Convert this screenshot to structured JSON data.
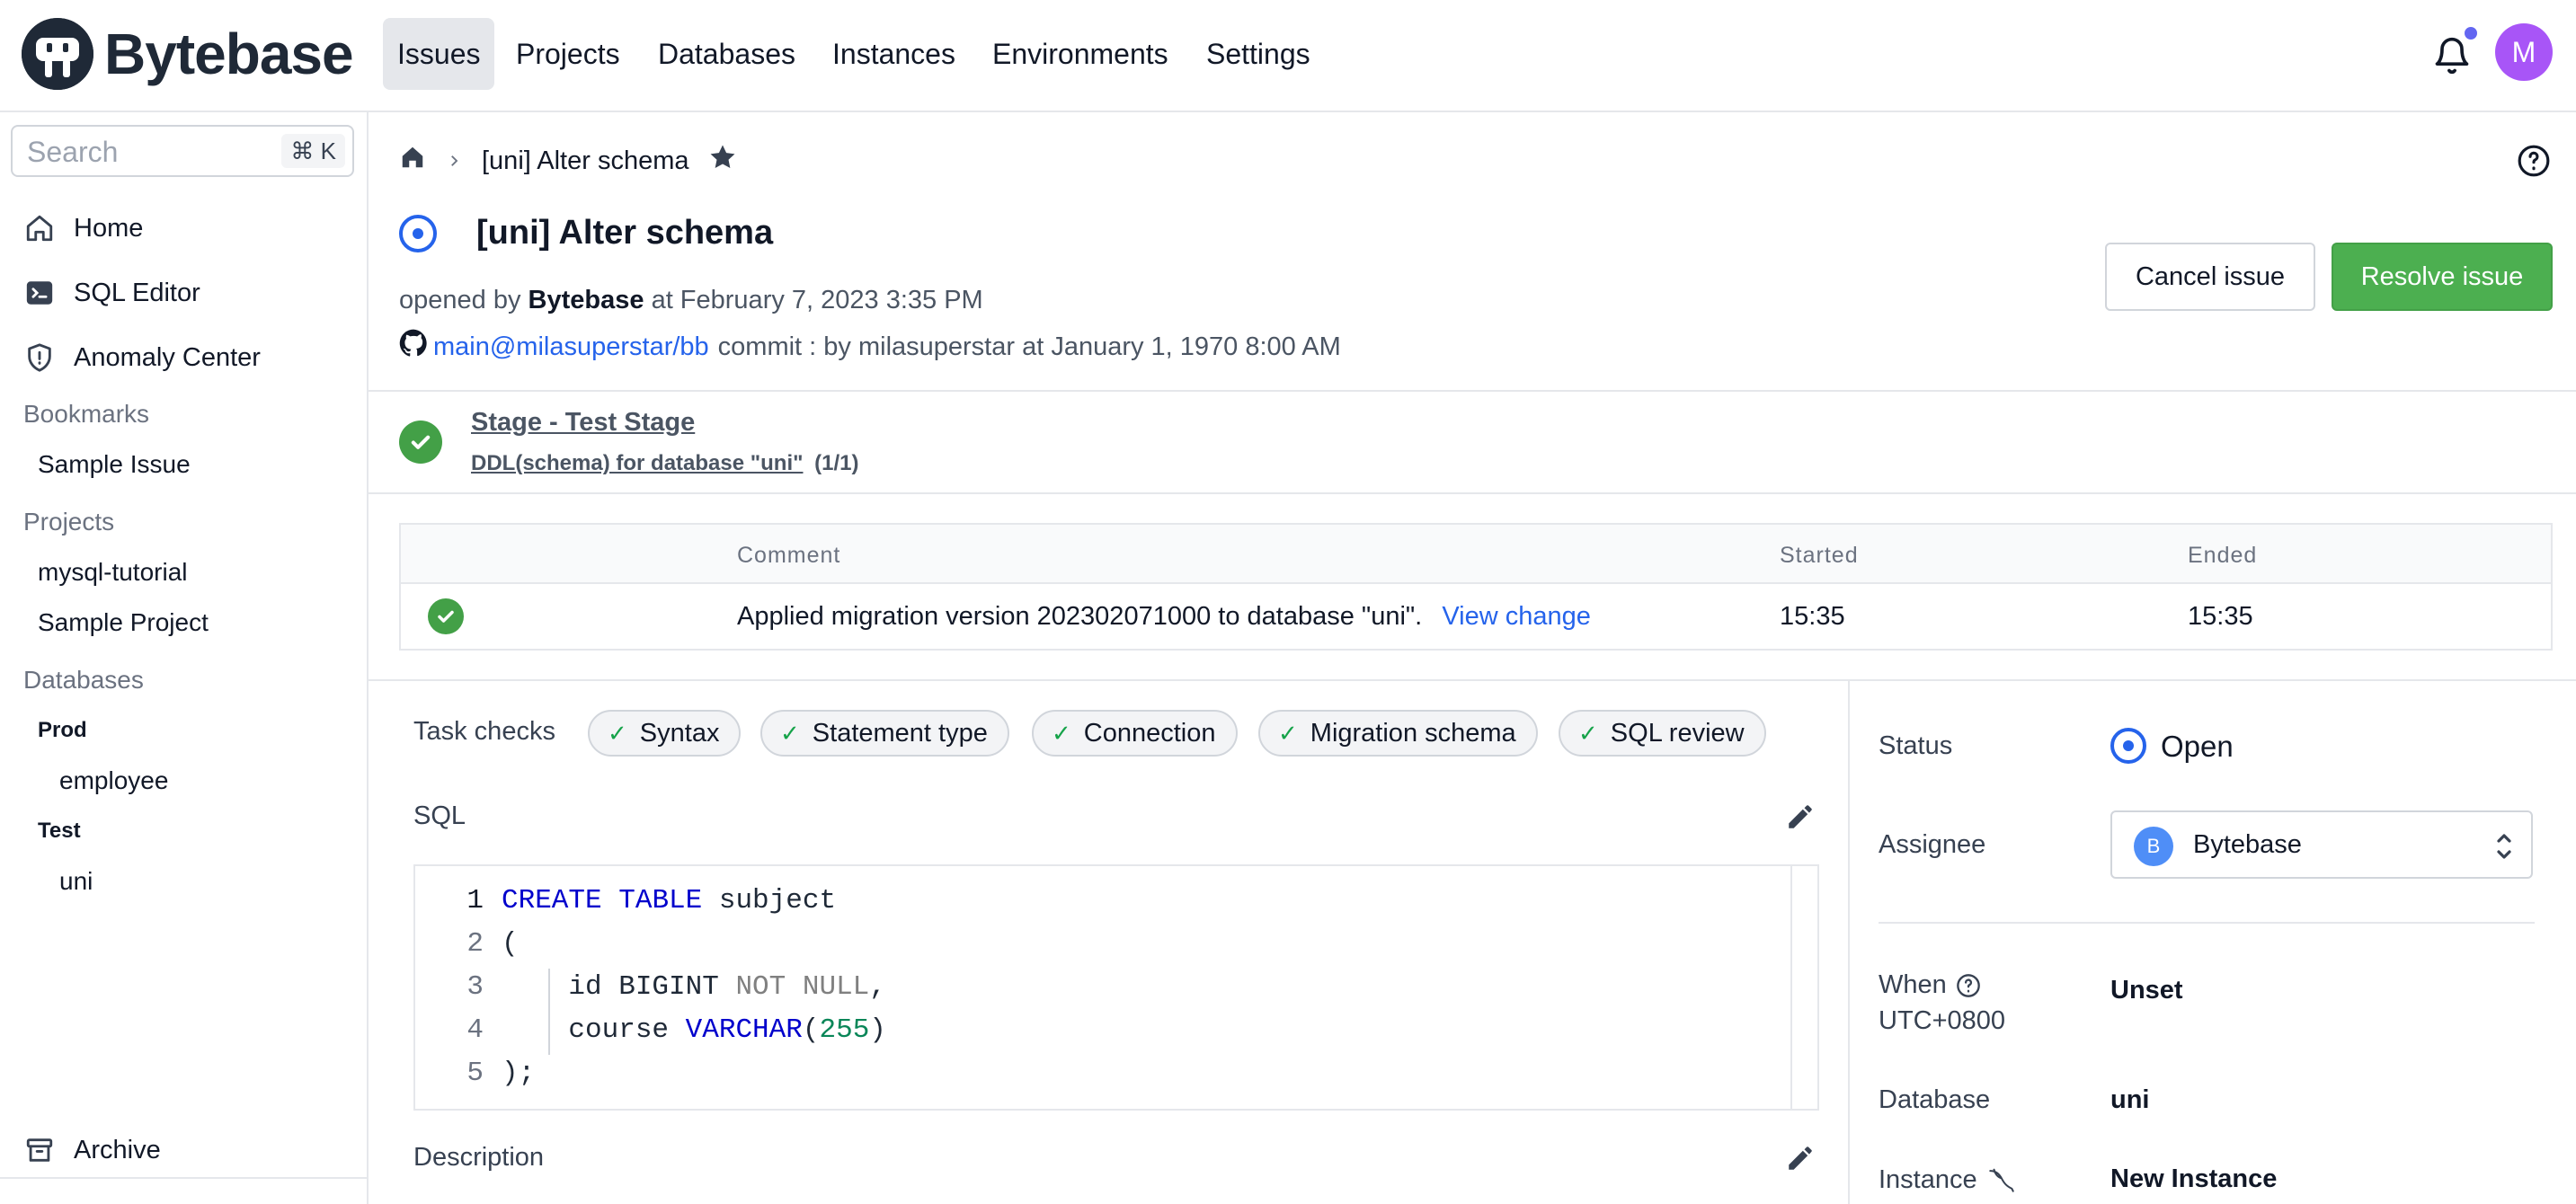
{
  "app": {
    "name": "Bytebase"
  },
  "nav": {
    "items": [
      {
        "label": "Issues",
        "active": true
      },
      {
        "label": "Projects",
        "active": false
      },
      {
        "label": "Databases",
        "active": false
      },
      {
        "label": "Instances",
        "active": false
      },
      {
        "label": "Environments",
        "active": false
      },
      {
        "label": "Settings",
        "active": false
      }
    ],
    "avatar_initial": "M"
  },
  "sidebar": {
    "search_placeholder": "Search",
    "search_shortcut": "⌘ K",
    "items": [
      {
        "label": "Home",
        "icon": "home-icon"
      },
      {
        "label": "SQL Editor",
        "icon": "terminal-icon"
      },
      {
        "label": "Anomaly Center",
        "icon": "shield-icon"
      }
    ],
    "bookmarks_title": "Bookmarks",
    "bookmarks": [
      "Sample Issue"
    ],
    "projects_title": "Projects",
    "projects": [
      "mysql-tutorial",
      "Sample Project"
    ],
    "databases_title": "Databases",
    "environments": [
      {
        "name": "Prod",
        "databases": [
          "employee"
        ]
      },
      {
        "name": "Test",
        "databases": [
          "uni"
        ]
      }
    ],
    "archive_label": "Archive"
  },
  "breadcrumb": {
    "current": "[uni] Alter schema"
  },
  "issue": {
    "title": "[uni] Alter schema",
    "opened_prefix": "opened by",
    "opened_by": "Bytebase",
    "opened_at": "at February 7, 2023 3:35 PM",
    "vcs_link": "main@milasuperstar/bb",
    "vcs_rest": "commit : by milasuperstar at January 1, 1970 8:00 AM",
    "cancel_label": "Cancel issue",
    "resolve_label": "Resolve issue"
  },
  "stage": {
    "title": "Stage - Test Stage",
    "task_link": "DDL(schema) for database \"uni\"",
    "task_count": "(1/1)"
  },
  "task_runs": {
    "headers": [
      "Comment",
      "Started",
      "Ended"
    ],
    "rows": [
      {
        "comment": "Applied migration version 202302071000 to database \"uni\".",
        "link": "View change",
        "started": "15:35",
        "ended": "15:35"
      }
    ]
  },
  "task_checks": {
    "label": "Task checks",
    "chips": [
      "Syntax",
      "Statement type",
      "Connection",
      "Migration schema",
      "SQL review"
    ]
  },
  "sql": {
    "label": "SQL",
    "line_numbers": [
      "1",
      "2",
      "3",
      "4",
      "5"
    ],
    "lines": [
      {
        "parts": [
          [
            "kw",
            "CREATE"
          ],
          [
            "pl",
            " "
          ],
          [
            "kw",
            "TABLE"
          ],
          [
            "pl",
            " subject"
          ]
        ]
      },
      {
        "parts": [
          [
            "pl",
            "("
          ]
        ]
      },
      {
        "parts": [
          [
            "pl",
            "    id BIGINT "
          ],
          [
            "gr",
            "NOT NULL"
          ],
          [
            "pl",
            ","
          ]
        ]
      },
      {
        "parts": [
          [
            "pl",
            "    course "
          ],
          [
            "kw",
            "VARCHAR"
          ],
          [
            "pl",
            "("
          ],
          [
            "num",
            "255"
          ],
          [
            "pl",
            ")"
          ]
        ]
      },
      {
        "parts": [
          [
            "pl",
            ");"
          ]
        ]
      }
    ]
  },
  "description": {
    "label": "Description"
  },
  "details": {
    "status_label": "Status",
    "status_value": "Open",
    "assignee_label": "Assignee",
    "assignee_initial": "B",
    "assignee_name": "Bytebase",
    "when_label": "When",
    "when_tz": "UTC+0800",
    "when_value": "Unset",
    "database_label": "Database",
    "database_value": "uni",
    "instance_label": "Instance",
    "instance_value": "New Instance"
  },
  "colors": {
    "primary": "#2563eb",
    "success": "#4caf50",
    "avatar": "#a855f7"
  }
}
